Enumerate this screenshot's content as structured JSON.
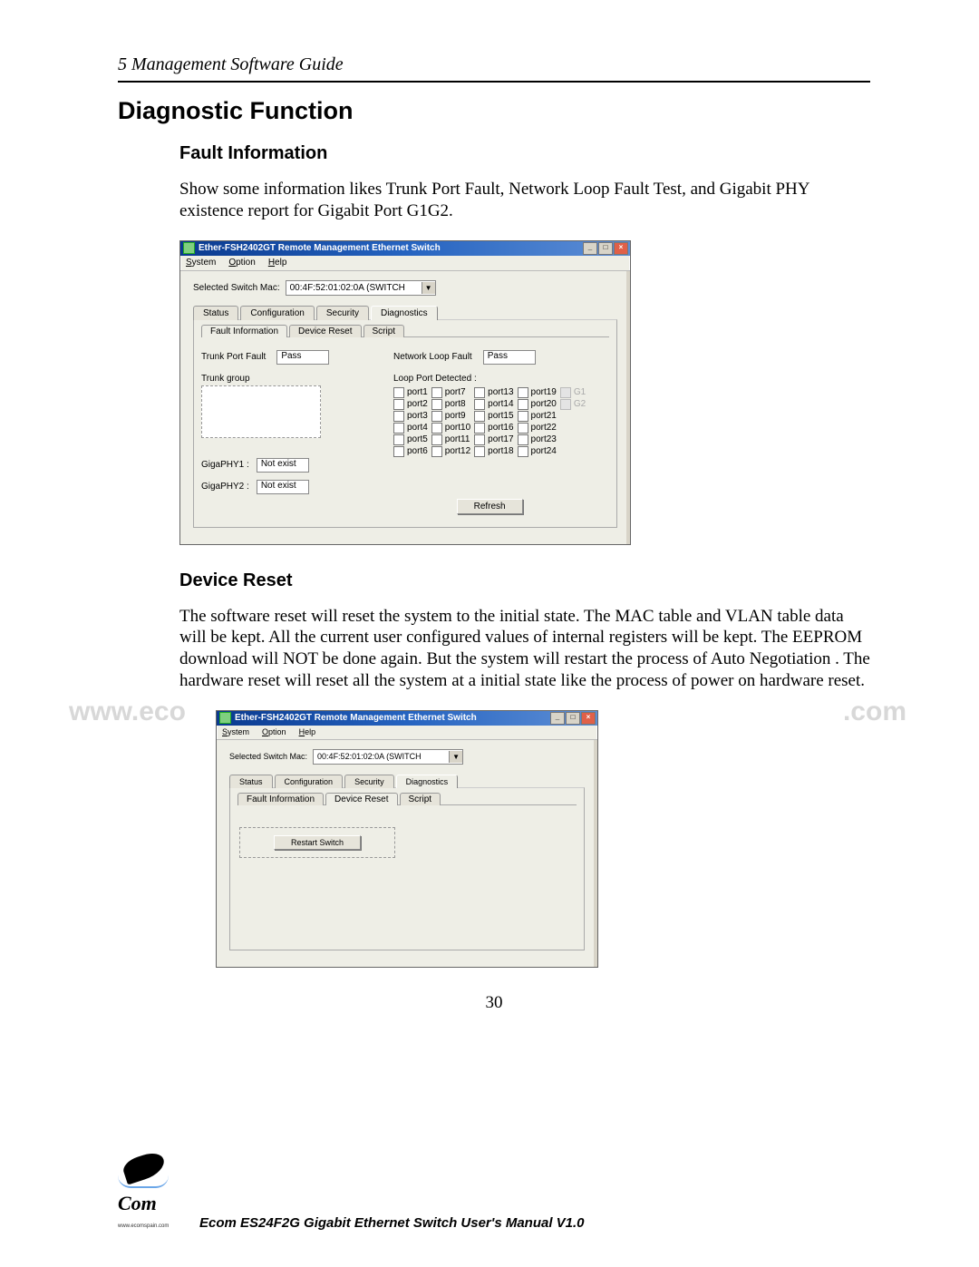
{
  "chapter_header": "5   Management Software Guide",
  "section_h1": "Diagnostic Function",
  "sub1_h2": "Fault Information",
  "sub1_text": "Show some information likes Trunk Port Fault, Network Loop Fault Test, and Gigabit PHY existence report for Gigabit Port G1G2.",
  "sub2_h2": "Device Reset",
  "sub2_text": "The software reset will reset the system to the initial state. The MAC table and VLAN table data will be kept. All the current user configured values of internal registers will be kept. The EEPROM download will NOT be done again. But the system will restart the process of Auto Negotiation . The hardware reset will reset all the system at a initial state like the process of power on hardware reset.",
  "page_number": "30",
  "footer_product": "Ecom ES24F2G Gigabit Ethernet Switch     User's Manual V1.0",
  "logo_text": "Com",
  "logo_sub": "www.ecomspain.com",
  "watermark_left": "www.eco",
  "watermark_right": ".com",
  "win": {
    "title": "Ether-FSH2402GT Remote Management Ethernet Switch",
    "min": "_",
    "max": "□",
    "close": "×",
    "menu": {
      "system": "System",
      "option": "Option",
      "help": "Help"
    },
    "mac_label": "Selected Switch Mac:",
    "mac_value": "00:4F:52:01:02:0A  (SWITCH",
    "main_tabs": {
      "status": "Status",
      "configuration": "Configuration",
      "security": "Security",
      "diagnostics": "Diagnostics"
    },
    "sub_tabs": {
      "fault": "Fault Information",
      "reset": "Device Reset",
      "script": "Script"
    },
    "fault": {
      "trunk_port_fault_label": "Trunk Port Fault",
      "trunk_port_fault_value": "Pass",
      "trunk_group_label": "Trunk group",
      "network_loop_label": "Network Loop Fault",
      "network_loop_value": "Pass",
      "loop_detected_label": "Loop Port Detected :",
      "ports_col1": [
        "port1",
        "port2",
        "port3",
        "port4",
        "port5",
        "port6"
      ],
      "ports_col2": [
        "port7",
        "port8",
        "port9",
        "port10",
        "port11",
        "port12"
      ],
      "ports_col3": [
        "port13",
        "port14",
        "port15",
        "port16",
        "port17",
        "port18"
      ],
      "ports_col4": [
        "port19",
        "port20",
        "port21",
        "port22",
        "port23",
        "port24"
      ],
      "ports_col5": [
        "G1",
        "G2"
      ],
      "giga1_label": "GigaPHY1 :",
      "giga1_value": "Not exist",
      "giga2_label": "GigaPHY2 :",
      "giga2_value": "Not exist",
      "refresh": "Refresh"
    },
    "reset": {
      "restart_btn": "Restart Switch"
    }
  }
}
